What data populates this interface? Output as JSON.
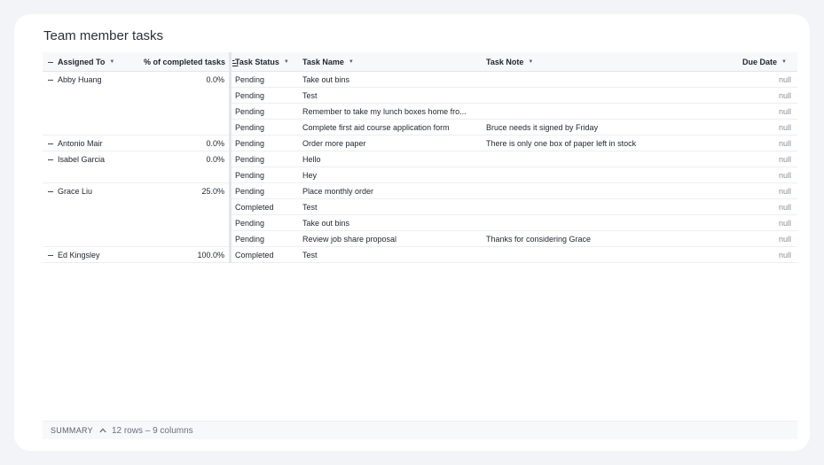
{
  "title": "Team member tasks",
  "columns": {
    "assigned_to": "Assigned To",
    "pct_completed": "% of completed tasks",
    "task_status": "Task Status",
    "task_name": "Task Name",
    "task_note": "Task Note",
    "due_date": "Due Date"
  },
  "groups": [
    {
      "name": "Abby Huang",
      "pct": "0.0%",
      "rows": [
        {
          "status": "Pending",
          "name": "Take out bins",
          "note": "",
          "due": "null"
        },
        {
          "status": "Pending",
          "name": "Test",
          "note": "",
          "due": "null"
        },
        {
          "status": "Pending",
          "name": "Remember to take my lunch boxes home fro...",
          "note": "",
          "due": "null"
        },
        {
          "status": "Pending",
          "name": "Complete first aid course application form",
          "note": "Bruce needs it signed by Friday",
          "due": "null"
        }
      ]
    },
    {
      "name": "Antonio Mair",
      "pct": "0.0%",
      "rows": [
        {
          "status": "Pending",
          "name": "Order more paper",
          "note": "There is only one box of paper left in stock",
          "due": "null"
        }
      ]
    },
    {
      "name": "Isabel Garcia",
      "pct": "0.0%",
      "rows": [
        {
          "status": "Pending",
          "name": "Hello",
          "note": "",
          "due": "null"
        },
        {
          "status": "Pending",
          "name": "Hey",
          "note": "",
          "due": "null"
        }
      ]
    },
    {
      "name": "Grace Liu",
      "pct": "25.0%",
      "rows": [
        {
          "status": "Pending",
          "name": "Place monthly order",
          "note": "",
          "due": "null"
        },
        {
          "status": "Completed",
          "name": "Test",
          "note": "",
          "due": "null"
        },
        {
          "status": "Pending",
          "name": "Take out bins",
          "note": "",
          "due": "null"
        },
        {
          "status": "Pending",
          "name": "Review job share proposal",
          "note": "Thanks for considering Grace",
          "due": "null"
        }
      ]
    },
    {
      "name": "Ed Kingsley",
      "pct": "100.0%",
      "rows": [
        {
          "status": "Completed",
          "name": "Test",
          "note": "",
          "due": "null"
        }
      ]
    }
  ],
  "footer": {
    "label": "SUMMARY",
    "count": "12 rows – 9 columns"
  }
}
